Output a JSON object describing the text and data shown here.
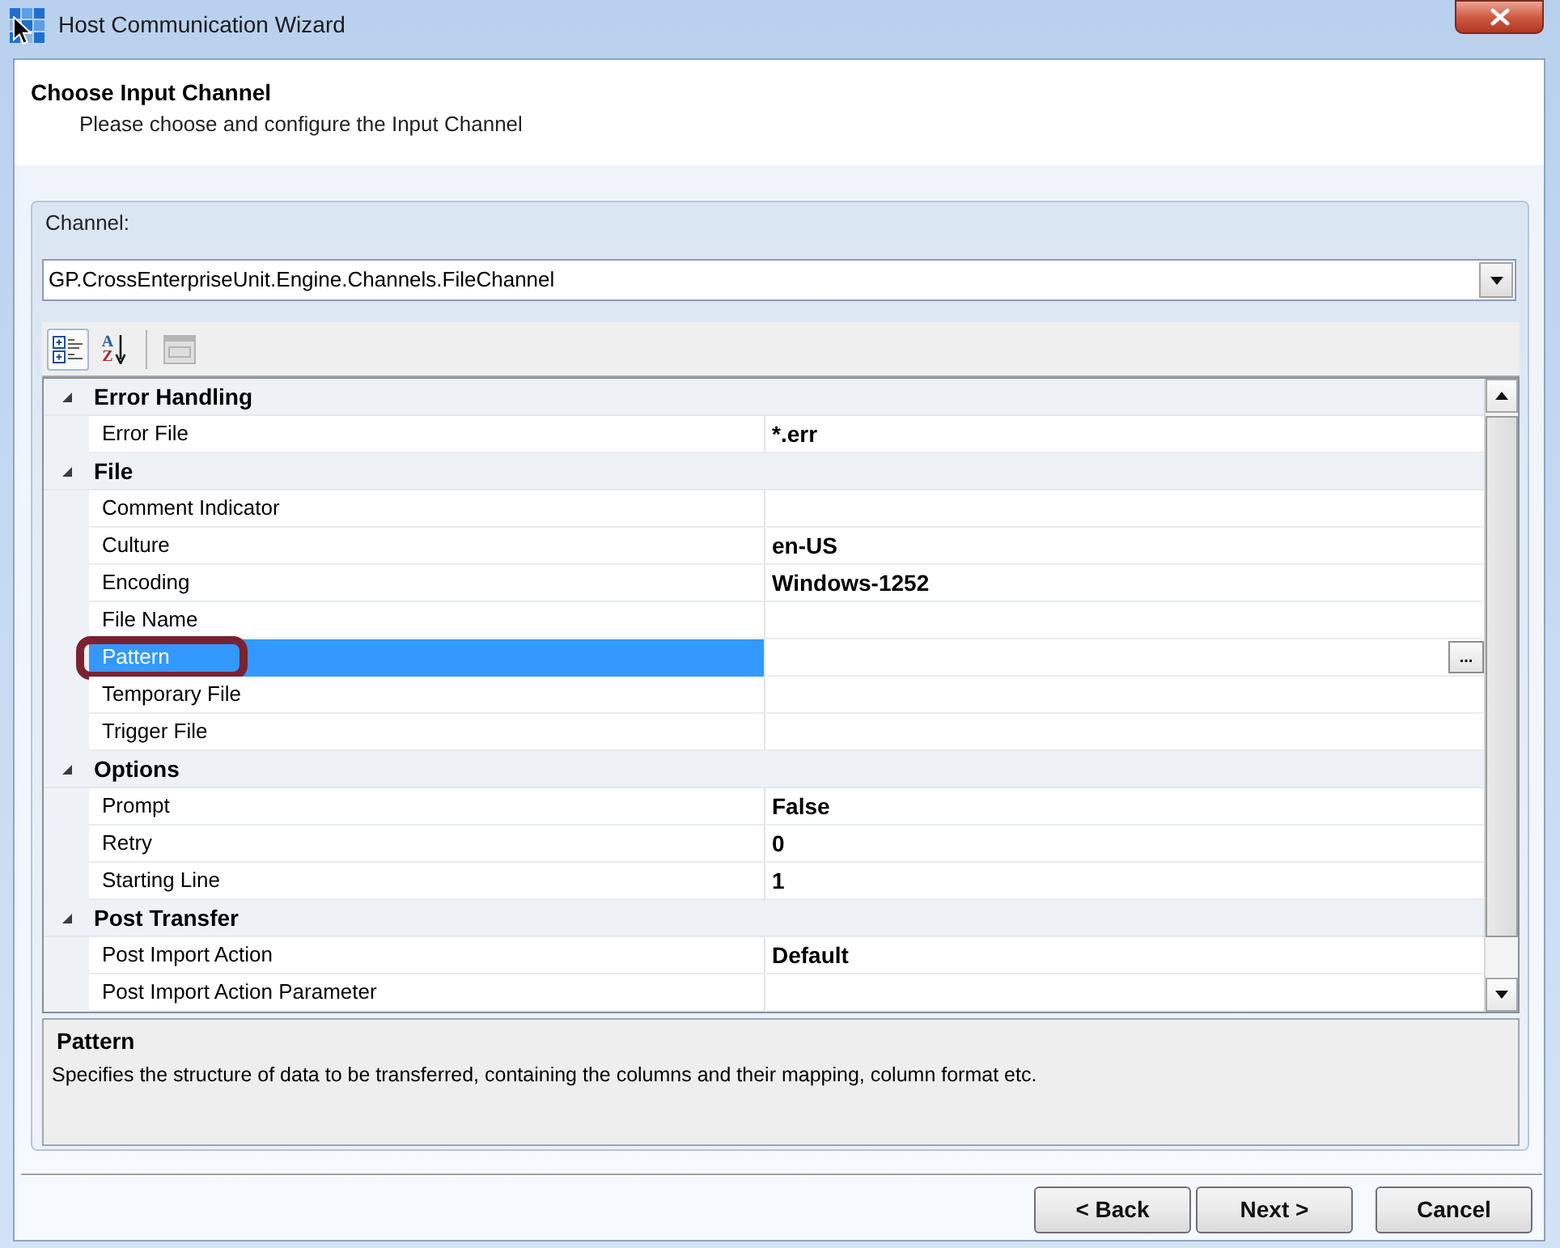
{
  "window": {
    "title": "Host Communication Wizard"
  },
  "header": {
    "title": "Choose Input Channel",
    "subtitle": "Please choose and configure the Input Channel"
  },
  "channel": {
    "label": "Channel:",
    "value": "GP.CrossEnterpriseUnit.Engine.Channels.FileChannel"
  },
  "toolbar": [
    {
      "kind": "categorized",
      "selected": true,
      "disabled": false
    },
    {
      "kind": "alphabetical",
      "letters": [
        "A",
        "Z"
      ],
      "selected": false,
      "disabled": false
    },
    {
      "kind": "property_pages",
      "selected": false,
      "disabled": true
    }
  ],
  "property_grid": {
    "categories": [
      {
        "name": "Error Handling",
        "expanded": true,
        "selected": false,
        "children": [
          {
            "name": "Error File",
            "value": "*.err",
            "selected": false,
            "circled": false
          }
        ]
      },
      {
        "name": "File",
        "expanded": true,
        "selected": false,
        "children": [
          {
            "name": "Comment Indicator",
            "selected": false,
            "circled": false
          },
          {
            "name": "Culture",
            "value": "en-US",
            "selected": false,
            "circled": false
          },
          {
            "name": "Encoding",
            "value": "Windows-1252",
            "selected": false,
            "circled": false
          },
          {
            "name": "File Name",
            "selected": false,
            "circled": false
          },
          {
            "name": "Pattern",
            "selected": true,
            "circled": true,
            "button": "..."
          },
          {
            "name": "Temporary File",
            "selected": false,
            "circled": false
          },
          {
            "name": "Trigger File",
            "selected": false,
            "circled": false
          }
        ]
      },
      {
        "name": "Options",
        "expanded": true,
        "selected": false,
        "children": [
          {
            "name": "Prompt",
            "value": "False",
            "selected": false,
            "circled": false
          },
          {
            "name": "Retry",
            "value": "0",
            "selected": false,
            "circled": false
          },
          {
            "name": "Starting Line",
            "value": "1",
            "selected": false,
            "circled": false
          }
        ]
      },
      {
        "name": "Post Transfer",
        "expanded": true,
        "selected": false,
        "children": [
          {
            "name": "Post Import Action",
            "value": "Default",
            "selected": false,
            "circled": false
          },
          {
            "name": "Post Import Action Parameter",
            "selected": false,
            "circled": false
          }
        ]
      }
    ]
  },
  "description": {
    "title": "Pattern",
    "text": "Specifies the structure of data to be transferred, containing the columns and their mapping, column format etc."
  },
  "buttons": [
    {
      "label": "< Back"
    },
    {
      "label": "Next >"
    },
    {
      "label": "Cancel"
    }
  ]
}
